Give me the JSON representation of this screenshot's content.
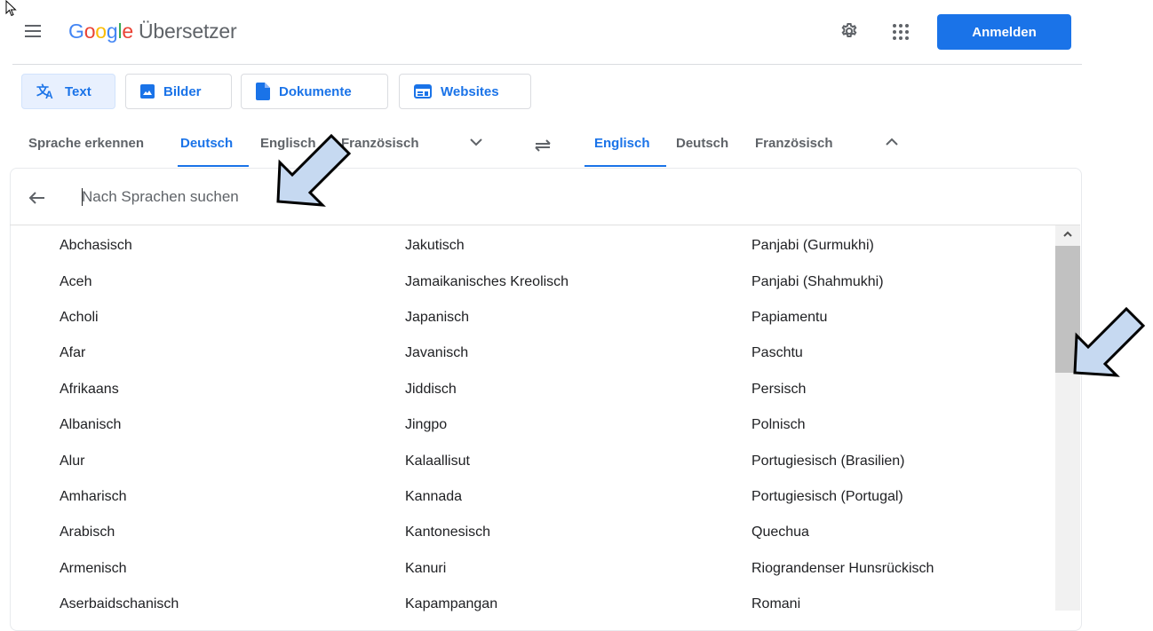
{
  "header": {
    "logo_letters": [
      "G",
      "o",
      "o",
      "g",
      "l",
      "e"
    ],
    "product": "Übersetzer",
    "signin_label": "Anmelden"
  },
  "mode_tabs": [
    {
      "label": "Text",
      "icon": "translate-icon",
      "active": true
    },
    {
      "label": "Bilder",
      "icon": "image-icon",
      "active": false
    },
    {
      "label": "Dokumente",
      "icon": "document-icon",
      "active": false
    },
    {
      "label": "Websites",
      "icon": "website-icon",
      "active": false
    }
  ],
  "source_langs": {
    "detect": "Sprache erkennen",
    "items": [
      "Deutsch",
      "Englisch",
      "Französisch"
    ],
    "selected": "Deutsch"
  },
  "target_langs": {
    "items": [
      "Englisch",
      "Deutsch",
      "Französisch"
    ],
    "selected": "Englisch"
  },
  "search": {
    "placeholder": "Nach Sprachen suchen",
    "value": ""
  },
  "languages": {
    "col1": [
      "Abchasisch",
      "Aceh",
      "Acholi",
      "Afar",
      "Afrikaans",
      "Albanisch",
      "Alur",
      "Amharisch",
      "Arabisch",
      "Armenisch",
      "Aserbaidschanisch"
    ],
    "col2": [
      "Jakutisch",
      "Jamaikanisches Kreolisch",
      "Japanisch",
      "Javanisch",
      "Jiddisch",
      "Jingpo",
      "Kalaallisut",
      "Kannada",
      "Kantonesisch",
      "Kanuri",
      "Kapampangan"
    ],
    "col3": [
      "Panjabi (Gurmukhi)",
      "Panjabi (Shahmukhi)",
      "Papiamentu",
      "Paschtu",
      "Persisch",
      "Polnisch",
      "Portugiesisch (Brasilien)",
      "Portugiesisch (Portugal)",
      "Quechua",
      "Riograndenser Hunsrückisch",
      "Romani"
    ]
  },
  "colors": {
    "accent": "#1a73e8",
    "annotation_fill": "#c6d9f1"
  }
}
